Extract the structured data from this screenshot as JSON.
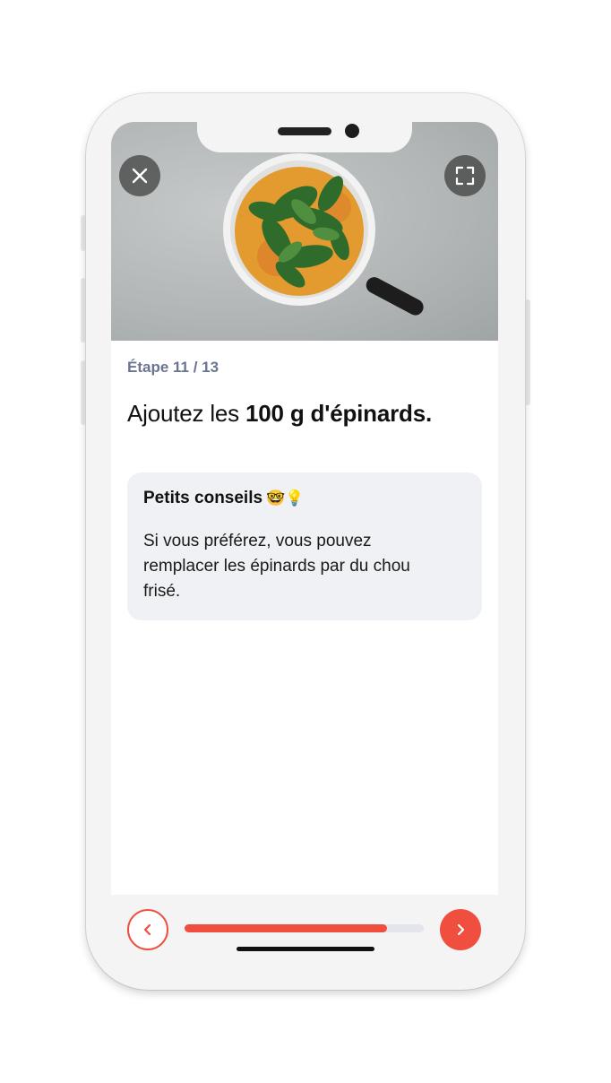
{
  "header": {
    "close_icon": "close-icon",
    "fullscreen_icon": "fullscreen-icon"
  },
  "step": {
    "label": "Étape 11 / 13",
    "instruction_prefix": "Ajoutez les ",
    "instruction_bold": "100 g d'épinards."
  },
  "tip": {
    "title": "Petits conseils",
    "emojis": "🤓💡",
    "body": "Si vous préférez, vous pouvez remplacer les épinards par du chou frisé."
  },
  "progress": {
    "fraction": 0.845
  },
  "colors": {
    "accent": "#f04e3e",
    "step_label": "#6b7491",
    "tip_background": "#f0f1f4"
  }
}
